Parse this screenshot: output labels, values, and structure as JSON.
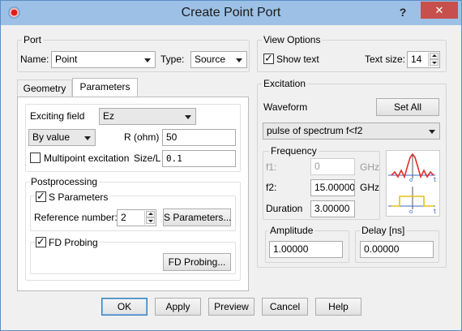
{
  "window": {
    "title": "Create Point Port",
    "help_label": "?",
    "close_label": "✕"
  },
  "port": {
    "group_title": "Port",
    "name_label": "Name:",
    "name_value": "Point",
    "type_label": "Type:",
    "type_value": "Source"
  },
  "view_options": {
    "group_title": "View Options",
    "show_text_label": "Show text",
    "show_text_checked": true,
    "text_size_label": "Text size:",
    "text_size_value": "14"
  },
  "tabs": [
    {
      "label": "Geometry",
      "active": false
    },
    {
      "label": "Parameters",
      "active": true
    }
  ],
  "parameters": {
    "exciting_field_label": "Exciting field",
    "exciting_field_value": "Ez",
    "mode_value": "By value",
    "r_label": "R (ohm)",
    "r_value": "50",
    "multipoint_label": "Multipoint excitation",
    "multipoint_checked": false,
    "size_label": "Size/L",
    "size_value": "0.1",
    "postprocessing_title": "Postprocessing",
    "s_params_label": "S Parameters",
    "s_params_checked": true,
    "ref_number_label": "Reference number:",
    "ref_number_value": "2",
    "s_params_button": "S Parameters...",
    "fd_probing_label": "FD Probing",
    "fd_probing_checked": true,
    "fd_probing_button": "FD Probing..."
  },
  "excitation": {
    "group_title": "Excitation",
    "waveform_label": "Waveform",
    "set_all_button": "Set All",
    "waveform_value": "pulse of spectrum f<f2",
    "frequency_title": "Frequency",
    "f1_label": "f1:",
    "f1_value": "0",
    "f1_unit": "GHz",
    "f2_label": "f2:",
    "f2_value": "15.00000",
    "f2_unit": "GHz",
    "duration_label": "Duration",
    "duration_value": "3.00000",
    "amplitude_title": "Amplitude",
    "amplitude_value": "1.00000",
    "delay_title": "Delay [ns]",
    "delay_value": "0.00000",
    "plot_labels": {
      "t_top": "t",
      "o_top": "o",
      "t_bottom": "t",
      "o_bottom": "o"
    }
  },
  "footer": {
    "ok": "OK",
    "apply": "Apply",
    "preview": "Preview",
    "cancel": "Cancel",
    "help": "Help"
  },
  "colors": {
    "titlebar": "#9dc1e6",
    "close": "#c7504c",
    "pulse_red": "#e0302c",
    "pulse_yellow": "#e6c21a"
  }
}
